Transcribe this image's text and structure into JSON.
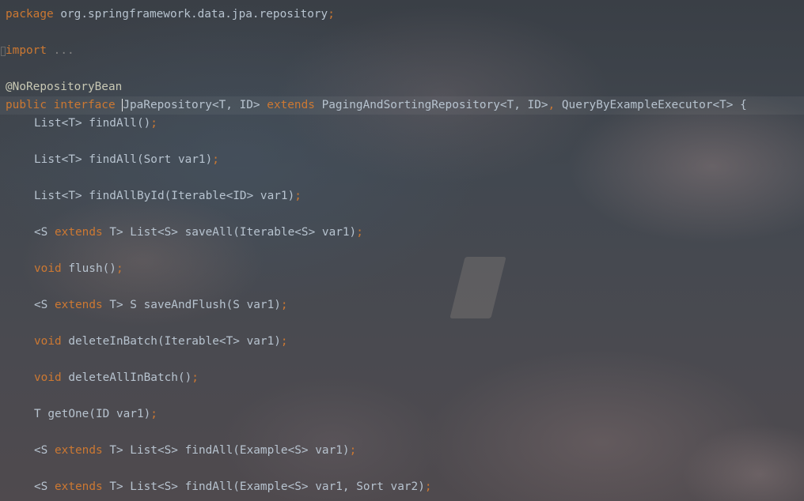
{
  "code": {
    "package_keyword": "package",
    "package_name": "org.springframework.data.jpa.repository",
    "import_keyword": "import",
    "import_folded": "...",
    "annotation": "@NoRepositoryBean",
    "decl_public": "public",
    "decl_interface": "interface",
    "decl_name_first": "J",
    "decl_name_rest": "paRepository",
    "decl_generics": "<T, ID>",
    "decl_extends": "extends",
    "decl_parent1": "PagingAndSortingRepository<T, ID>",
    "decl_comma": ",",
    "decl_parent2": "QueryByExampleExecutor<T>",
    "decl_brace": "{",
    "methods": [
      {
        "pre": "",
        "kw": "",
        "sig": "List<T> findAll()"
      },
      {
        "pre": "",
        "kw": "",
        "sig": "List<T> findAll(Sort var1)"
      },
      {
        "pre": "",
        "kw": "",
        "sig": "List<T> findAllById(Iterable<ID> var1)"
      },
      {
        "pre": "<S ",
        "kw": "extends",
        "sig": " T> List<S> saveAll(Iterable<S> var1)"
      },
      {
        "pre": "",
        "kw": "void",
        "sig": " flush()"
      },
      {
        "pre": "<S ",
        "kw": "extends",
        "sig": " T> S saveAndFlush(S var1)"
      },
      {
        "pre": "",
        "kw": "void",
        "sig": " deleteInBatch(Iterable<T> var1)"
      },
      {
        "pre": "",
        "kw": "void",
        "sig": " deleteAllInBatch()"
      },
      {
        "pre": "",
        "kw": "",
        "sig": "T getOne(ID var1)"
      },
      {
        "pre": "<S ",
        "kw": "extends",
        "sig": " T> List<S> findAll(Example<S> var1)"
      },
      {
        "pre": "<S ",
        "kw": "extends",
        "sig": " T> List<S> findAll(Example<S> var1, Sort var2)"
      }
    ],
    "semicolon": ";"
  },
  "colors": {
    "keyword": "#cc7832",
    "text": "#b7c3cf",
    "annotation": "#c8c8b4"
  }
}
